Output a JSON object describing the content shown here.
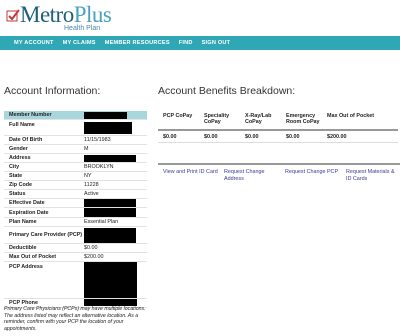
{
  "brand": {
    "name_main": "Metro",
    "name_plus": "Plus",
    "subtitle": "Health Plan"
  },
  "nav": {
    "items": [
      "MY ACCOUNT",
      "MY CLAIMS",
      "MEMBER RESOURCES",
      "FIND",
      "SIGN OUT"
    ]
  },
  "account": {
    "heading": "Account Information:",
    "rows": [
      {
        "label": "Member Number",
        "value": ""
      },
      {
        "label": "Full Name",
        "value": ""
      },
      {
        "label": "Date Of Birth",
        "value": "11/15/1983"
      },
      {
        "label": "Gender",
        "value": "M"
      },
      {
        "label": "Address",
        "value": ""
      },
      {
        "label": "City",
        "value": "BROOKLYN"
      },
      {
        "label": "State",
        "value": "NY"
      },
      {
        "label": "Zip Code",
        "value": "11228"
      },
      {
        "label": "Status",
        "value": "Active"
      },
      {
        "label": "Effective Date",
        "value": ""
      },
      {
        "label": "Expiration Date",
        "value": ""
      },
      {
        "label": "Plan Name",
        "value": "Essential Plan"
      },
      {
        "label": "Primary Care Provider (PCP)",
        "value": ""
      },
      {
        "label": "Deductible",
        "value": "$0.00"
      },
      {
        "label": "Max Out of Pocket",
        "value": "$200.00"
      },
      {
        "label": "PCP Address",
        "value": ""
      },
      {
        "label": "PCP Phone",
        "value": ""
      }
    ]
  },
  "benefits": {
    "heading": "Account Benefits Breakdown:",
    "columns": [
      "PCP CoPay",
      "Speciality CoPay",
      "X-Ray/Lab CoPay",
      "Emergency Room CoPay",
      "Max Out of Pocket"
    ],
    "values": [
      "$0.00",
      "$0.00",
      "$0.00",
      "$0.00",
      "$200.00"
    ]
  },
  "links": [
    "View and Print ID Card",
    "Request Change Address",
    "Request Change PCP",
    "Request Materials & ID Cards"
  ],
  "footnote": "Primary Care Physicians (PCPs) may have multiple locations. The address listed may reflect an alternative location. As a reminder, confirm with your PCP the location of your appointments."
}
